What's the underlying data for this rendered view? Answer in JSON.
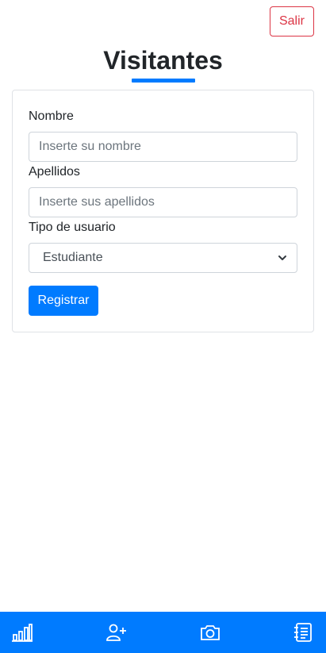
{
  "header": {
    "logout_label": "Salir",
    "title": "Visitantes"
  },
  "form": {
    "name_label": "Nombre",
    "name_placeholder": "Inserte su nombre",
    "surname_label": "Apellidos",
    "surname_placeholder": "Inserte sus apellidos",
    "user_type_label": "Tipo de usuario",
    "user_type_selected": "Estudiante",
    "submit_label": "Registrar"
  },
  "bottom_nav": {
    "items": [
      {
        "icon": "bar-chart-icon"
      },
      {
        "icon": "add-user-icon"
      },
      {
        "icon": "camera-icon"
      },
      {
        "icon": "notebook-icon"
      }
    ]
  },
  "colors": {
    "primary": "#007bff",
    "danger": "#dc3545",
    "text": "#212529",
    "border": "#ced4da"
  }
}
